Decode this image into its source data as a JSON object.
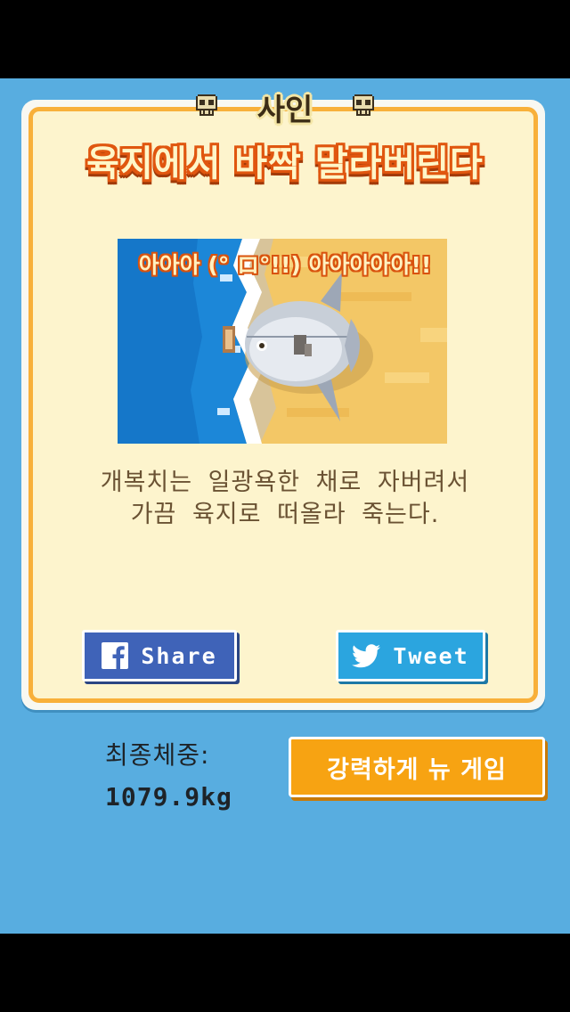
{
  "card": {
    "cause_label": "사인",
    "death_title": "육지에서 바짝 말라버린다",
    "scream": "아아아 (° ロ°!!) 아아아아아!!",
    "description_line1": "개복치는 일광욕한 채로 자버려서",
    "description_line2": "가끔 육지로 떠올라 죽는다."
  },
  "share": {
    "facebook_label": "Share",
    "twitter_label": "Tweet"
  },
  "result": {
    "weight_label": "최종체중:",
    "weight_value": "1079.9kg"
  },
  "actions": {
    "new_game_label": "강력하게 뉴 게임"
  },
  "icons": {
    "left_skull": "skull-icon",
    "right_skull": "skull-icon",
    "facebook": "facebook-icon",
    "twitter": "twitter-bird-icon"
  },
  "colors": {
    "background": "#58ade0",
    "card_border": "#f8b03a",
    "title_outline": "#e0560f",
    "facebook": "#3f63b8",
    "twitter": "#2ba5df",
    "new_game": "#f7a312"
  }
}
